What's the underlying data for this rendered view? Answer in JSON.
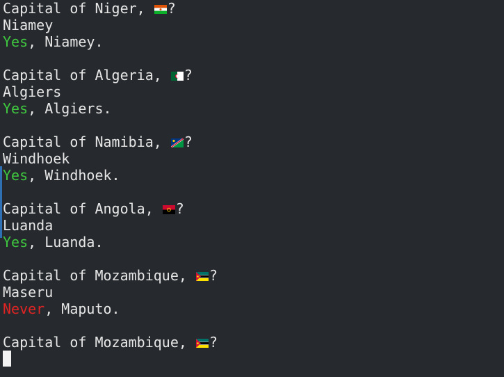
{
  "session": {
    "qa": [
      {
        "question_prefix": "Capital of Niger, ",
        "question_suffix": "?",
        "flag": "niger-flag-icon",
        "answer": "Niamey",
        "verdict": "Yes",
        "verdict_rest": ", Niamey.",
        "verdict_color": "#3fc83f"
      },
      {
        "question_prefix": "Capital of Algeria, ",
        "question_suffix": "?",
        "flag": "algeria-flag-icon",
        "answer": "Algiers",
        "verdict": "Yes",
        "verdict_rest": ", Algiers.",
        "verdict_color": "#3fc83f"
      },
      {
        "question_prefix": "Capital of Namibia, ",
        "question_suffix": "?",
        "flag": "namibia-flag-icon",
        "answer": "Windhoek",
        "verdict": "Yes",
        "verdict_rest": ", Windhoek.",
        "verdict_color": "#3fc83f"
      },
      {
        "question_prefix": "Capital of Angola, ",
        "question_suffix": "?",
        "flag": "angola-flag-icon",
        "answer": "Luanda",
        "verdict": "Yes",
        "verdict_rest": ", Luanda.",
        "verdict_color": "#3fc83f"
      },
      {
        "question_prefix": "Capital of Mozambique, ",
        "question_suffix": "?",
        "flag": "mozambique-flag-icon",
        "answer": "Maseru",
        "verdict": "Never",
        "verdict_rest": ", Maputo.",
        "verdict_color": "#e02424"
      }
    ],
    "current_prompt": {
      "question_prefix": "Capital of Mozambique, ",
      "question_suffix": "?",
      "flag": "mozambique-flag-icon",
      "input_value": ""
    }
  },
  "colors": {
    "background": "#262a2e",
    "text": "#e6e6e6",
    "correct": "#3fc83f",
    "incorrect": "#e02424",
    "scroll_marker": "#2f6fb3"
  }
}
